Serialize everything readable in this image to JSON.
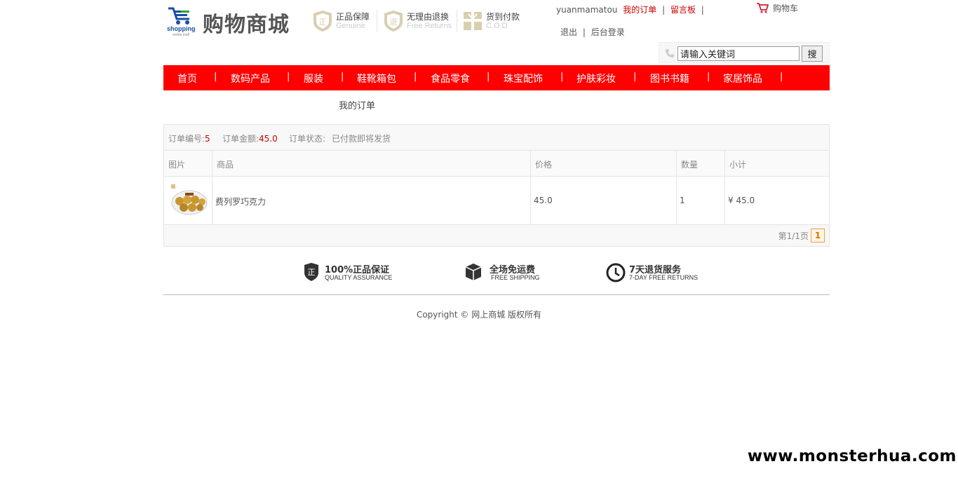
{
  "brand": {
    "logo_text": "shopping",
    "logo_sub": "online mall",
    "site_name": "购物商城"
  },
  "badges": [
    {
      "title": "正品保障",
      "sub": "Genuine",
      "icon": "shield-zheng-icon"
    },
    {
      "title": "无理由退换",
      "sub": "Free Returns",
      "icon": "shield-return-icon"
    },
    {
      "title": "货到付款",
      "sub": "C.O.D",
      "icon": "gift-box-icon"
    }
  ],
  "user": {
    "name": "yuanmamatou",
    "my_orders": "我的订单",
    "separator": "|",
    "message_board": "留言板",
    "logout": "退出",
    "admin_login": "后台登录"
  },
  "cart": {
    "label": "购物车"
  },
  "search": {
    "value": "请输入关键词",
    "button": "搜"
  },
  "nav": [
    {
      "label": "首页"
    },
    {
      "label": "数码产品"
    },
    {
      "label": "服装"
    },
    {
      "label": "鞋靴箱包"
    },
    {
      "label": "食品零食"
    },
    {
      "label": "珠宝配饰"
    },
    {
      "label": "护肤彩妆"
    },
    {
      "label": "图书书籍"
    },
    {
      "label": "家居饰品"
    }
  ],
  "nav_sep": "|",
  "breadcrumb": "我的订单",
  "order": {
    "no_label": "订单编号:",
    "no_value": "5",
    "total_label": "订单金额:",
    "total_value": "45.0",
    "status_label": "订单状态:",
    "status_value": "已付款即将发货",
    "columns": [
      "图片",
      "商品",
      "价格",
      "数量",
      "小计"
    ],
    "items": [
      {
        "name": "费列罗巧克力",
        "price": "45.0",
        "qty": "1",
        "subtotal": "¥ 45.0"
      }
    ],
    "pager_text": "第1/1页",
    "pager_current": "1"
  },
  "services": [
    {
      "title": "100%正品保证",
      "sub": "QUALITY ASSURANCE",
      "icon": "shield-zheng-icon"
    },
    {
      "title": "全场免运费",
      "sub": "FREE SHIPPING",
      "icon": "cube-box-icon"
    },
    {
      "title": "7天退货服务",
      "sub": "7-DAY FREE RETURNS",
      "icon": "clock-icon"
    }
  ],
  "copyright": "Copyright © 网上商城 版权所有",
  "watermark": "www.monsterhua.com",
  "colors": {
    "accent": "#fe0000",
    "price": "#cc0000",
    "badge": "#d8cfb0"
  }
}
